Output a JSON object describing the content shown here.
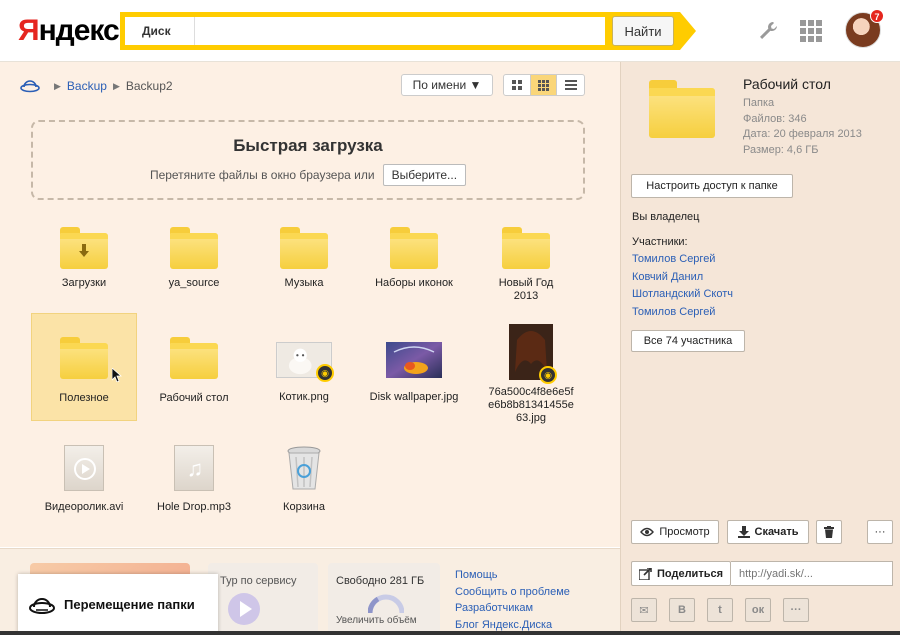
{
  "header": {
    "logo_first": "Я",
    "logo_rest": "ндекс",
    "search_scope": "Диск",
    "search_value": "",
    "search_button": "Найти",
    "notifications": "7"
  },
  "breadcrumbs": [
    "Backup",
    "Backup2"
  ],
  "toolbar": {
    "sort_label": "По имени ▼"
  },
  "upload": {
    "title": "Быстрая загрузка",
    "hint": "Перетяните файлы в окно браузера или",
    "choose_label": "Выберите..."
  },
  "items": [
    {
      "label": "Загрузки"
    },
    {
      "label": "ya_source"
    },
    {
      "label": "Музыка"
    },
    {
      "label": "Наборы иконок"
    },
    {
      "label": "Новый Год 2013"
    },
    {
      "label": "Полезное"
    },
    {
      "label": "Рабочий стол"
    },
    {
      "label": "Котик.png"
    },
    {
      "label": "Disk wallpaper.jpg"
    },
    {
      "label": "76a500c4f8e6e5fe6b8b81341455e63.jpg"
    },
    {
      "label": "Видеоролик.avi"
    },
    {
      "label": "Hole Drop.mp3"
    },
    {
      "label": "Корзина"
    }
  ],
  "footer": {
    "tour": "Тур по сервису",
    "free_space": "Свободно 281 ГБ",
    "increase": "Увеличить объём",
    "links": [
      "Помощь",
      "Сообщить о проблеме",
      "Разработчикам",
      "Блог Яндекс.Диска"
    ]
  },
  "toast": {
    "text": "Перемещение папки"
  },
  "panel": {
    "title": "Рабочий стол",
    "type": "Папка",
    "files": "Файлов: 346",
    "date": "Дата: 20 февраля 2013",
    "size": "Размер: 4,6 ГБ",
    "access_button": "Настроить доступ к папке",
    "owner": "Вы владелец",
    "members_label": "Участники:",
    "members": [
      "Томилов Сергей",
      "Ковчий Данил",
      "Шотландский Скотч",
      "Томилов Сергей"
    ],
    "all_members_button": "Все 74 участника",
    "view_button": "Просмотр",
    "download_button": "Скачать",
    "more_button": "···",
    "share_button": "Поделиться",
    "share_placeholder": "http://yadi.sk/...",
    "socials": [
      "✉",
      "В",
      "t",
      "ок",
      "···"
    ]
  },
  "colors": {
    "accent": "#ffcc00",
    "link": "#2b5fb6",
    "main_bg": "#fdf0e4",
    "panel_bg": "#f5e6d8"
  }
}
